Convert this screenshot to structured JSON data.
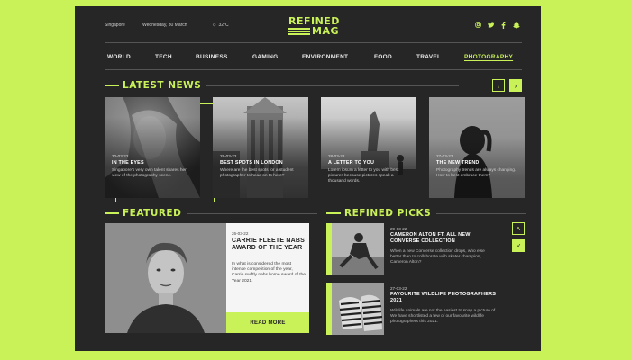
{
  "header": {
    "location": "Singapore",
    "date": "Wednesday, 30 March",
    "weather": "32°C",
    "logo_line1": "REFINED",
    "logo_line2": "MAG",
    "social": [
      "instagram-icon",
      "twitter-icon",
      "facebook-icon",
      "snapchat-icon"
    ]
  },
  "nav": [
    "WORLD",
    "TECH",
    "BUSINESS",
    "GAMING",
    "ENVIRONMENT",
    "FOOD",
    "TRAVEL",
    "PHOTOGRAPHY"
  ],
  "nav_active": "PHOTOGRAPHY",
  "latest": {
    "title": "LATEST NEWS",
    "prev": "‹",
    "next": "›",
    "cards": [
      {
        "date": "30-03-22",
        "title": "IN THE EYES",
        "desc": "Singapore's very own talent shares her view of the photography scene."
      },
      {
        "date": "29-03-22",
        "title": "BEST SPOTS IN LONDON",
        "desc": "Where are the best spots for a student photographer to head on to here?"
      },
      {
        "date": "28-03-22",
        "title": "A LETTER TO YOU",
        "desc": "Lorem ipsum a letter to you with best pictures because pictures speak a thousand words."
      },
      {
        "date": "27-03-22",
        "title": "THE NEW TREND",
        "desc": "Photography trends are always changing. How to best embrace them?"
      }
    ]
  },
  "featured": {
    "title": "FEATURED",
    "date": "26-03-22",
    "headline": "CARRIE FLEETE NABS AWARD OF THE YEAR",
    "desc": "In what is considered the most intense competition of the year, Carrie swiftly nabs home Award of the Year 2021.",
    "button": "READ MORE"
  },
  "picks": {
    "title": "REFINED PICKS",
    "up": "˄",
    "down": "˅",
    "items": [
      {
        "date": "29-03-22",
        "title": "CAMERON ALTON FT. ALL NEW CONVERSE COLLECTION",
        "desc": "When a new Converse collection drops, who else better than to collaborate with skater champion, Cameron Alton?"
      },
      {
        "date": "27-03-22",
        "title": "FAVOURITE WILDLIFE PHOTOGRAPHERS 2021",
        "desc": "Wildlife animals are not the easiest to snap a picture of. We have shortlisted a few of our favourite wildlife photographers this 2021."
      }
    ]
  },
  "colors": {
    "accent": "#c9f158",
    "panel": "#262626"
  }
}
